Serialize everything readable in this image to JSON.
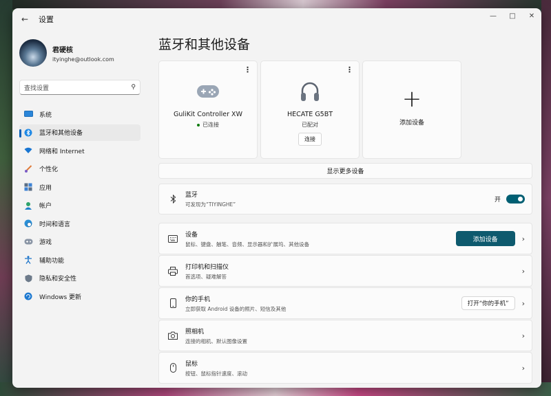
{
  "window": {
    "app_title": "设置"
  },
  "profile": {
    "name": "君硬核",
    "email": "ityinghe@outlook.com"
  },
  "search": {
    "placeholder": "查找设置"
  },
  "sidebar": {
    "items": [
      {
        "label": "系统",
        "icon": "monitor-icon"
      },
      {
        "label": "蓝牙和其他设备",
        "icon": "bluetooth-icon",
        "active": true
      },
      {
        "label": "网络和 Internet",
        "icon": "wifi-icon"
      },
      {
        "label": "个性化",
        "icon": "brush-icon"
      },
      {
        "label": "应用",
        "icon": "apps-icon"
      },
      {
        "label": "帐户",
        "icon": "account-icon"
      },
      {
        "label": "时间和语言",
        "icon": "globe-clock-icon"
      },
      {
        "label": "游戏",
        "icon": "gamepad-icon"
      },
      {
        "label": "辅助功能",
        "icon": "accessibility-icon"
      },
      {
        "label": "隐私和安全性",
        "icon": "shield-icon"
      },
      {
        "label": "Windows 更新",
        "icon": "update-icon"
      }
    ]
  },
  "main": {
    "title": "蓝牙和其他设备",
    "devices": [
      {
        "name": "GuliKit Controller XW",
        "status": "已连接",
        "icon": "gamepad-icon"
      },
      {
        "name": "HECATE G5BT",
        "status": "已配对",
        "button": "连接",
        "icon": "headphones-icon"
      }
    ],
    "add_device_card": "添加设备",
    "show_more": "显示更多设备",
    "bluetooth": {
      "title": "蓝牙",
      "subtitle": "可发现为“TIYINGHE”",
      "toggle_label": "开"
    },
    "rows": [
      {
        "title": "设备",
        "subtitle": "鼠标、键盘、触笔、音频、显示器和扩展坞、其他设备",
        "button": "添加设备",
        "icon": "keyboard-icon"
      },
      {
        "title": "打印机和扫描仪",
        "subtitle": "首选项、疑难解答",
        "icon": "printer-icon"
      },
      {
        "title": "你的手机",
        "subtitle": "立即获取 Android 设备的照片、短信及其他",
        "button": "打开“你的手机”",
        "icon": "phone-icon"
      },
      {
        "title": "照相机",
        "subtitle": "连接的相机、默认图像设置",
        "icon": "camera-icon"
      },
      {
        "title": "鼠标",
        "subtitle": "按钮、鼠标指针速度、滚动",
        "icon": "mouse-icon"
      }
    ]
  },
  "colors": {
    "accent": "#005fb8",
    "toggle_on": "#005f73",
    "primary_button": "#0e5a6e"
  }
}
